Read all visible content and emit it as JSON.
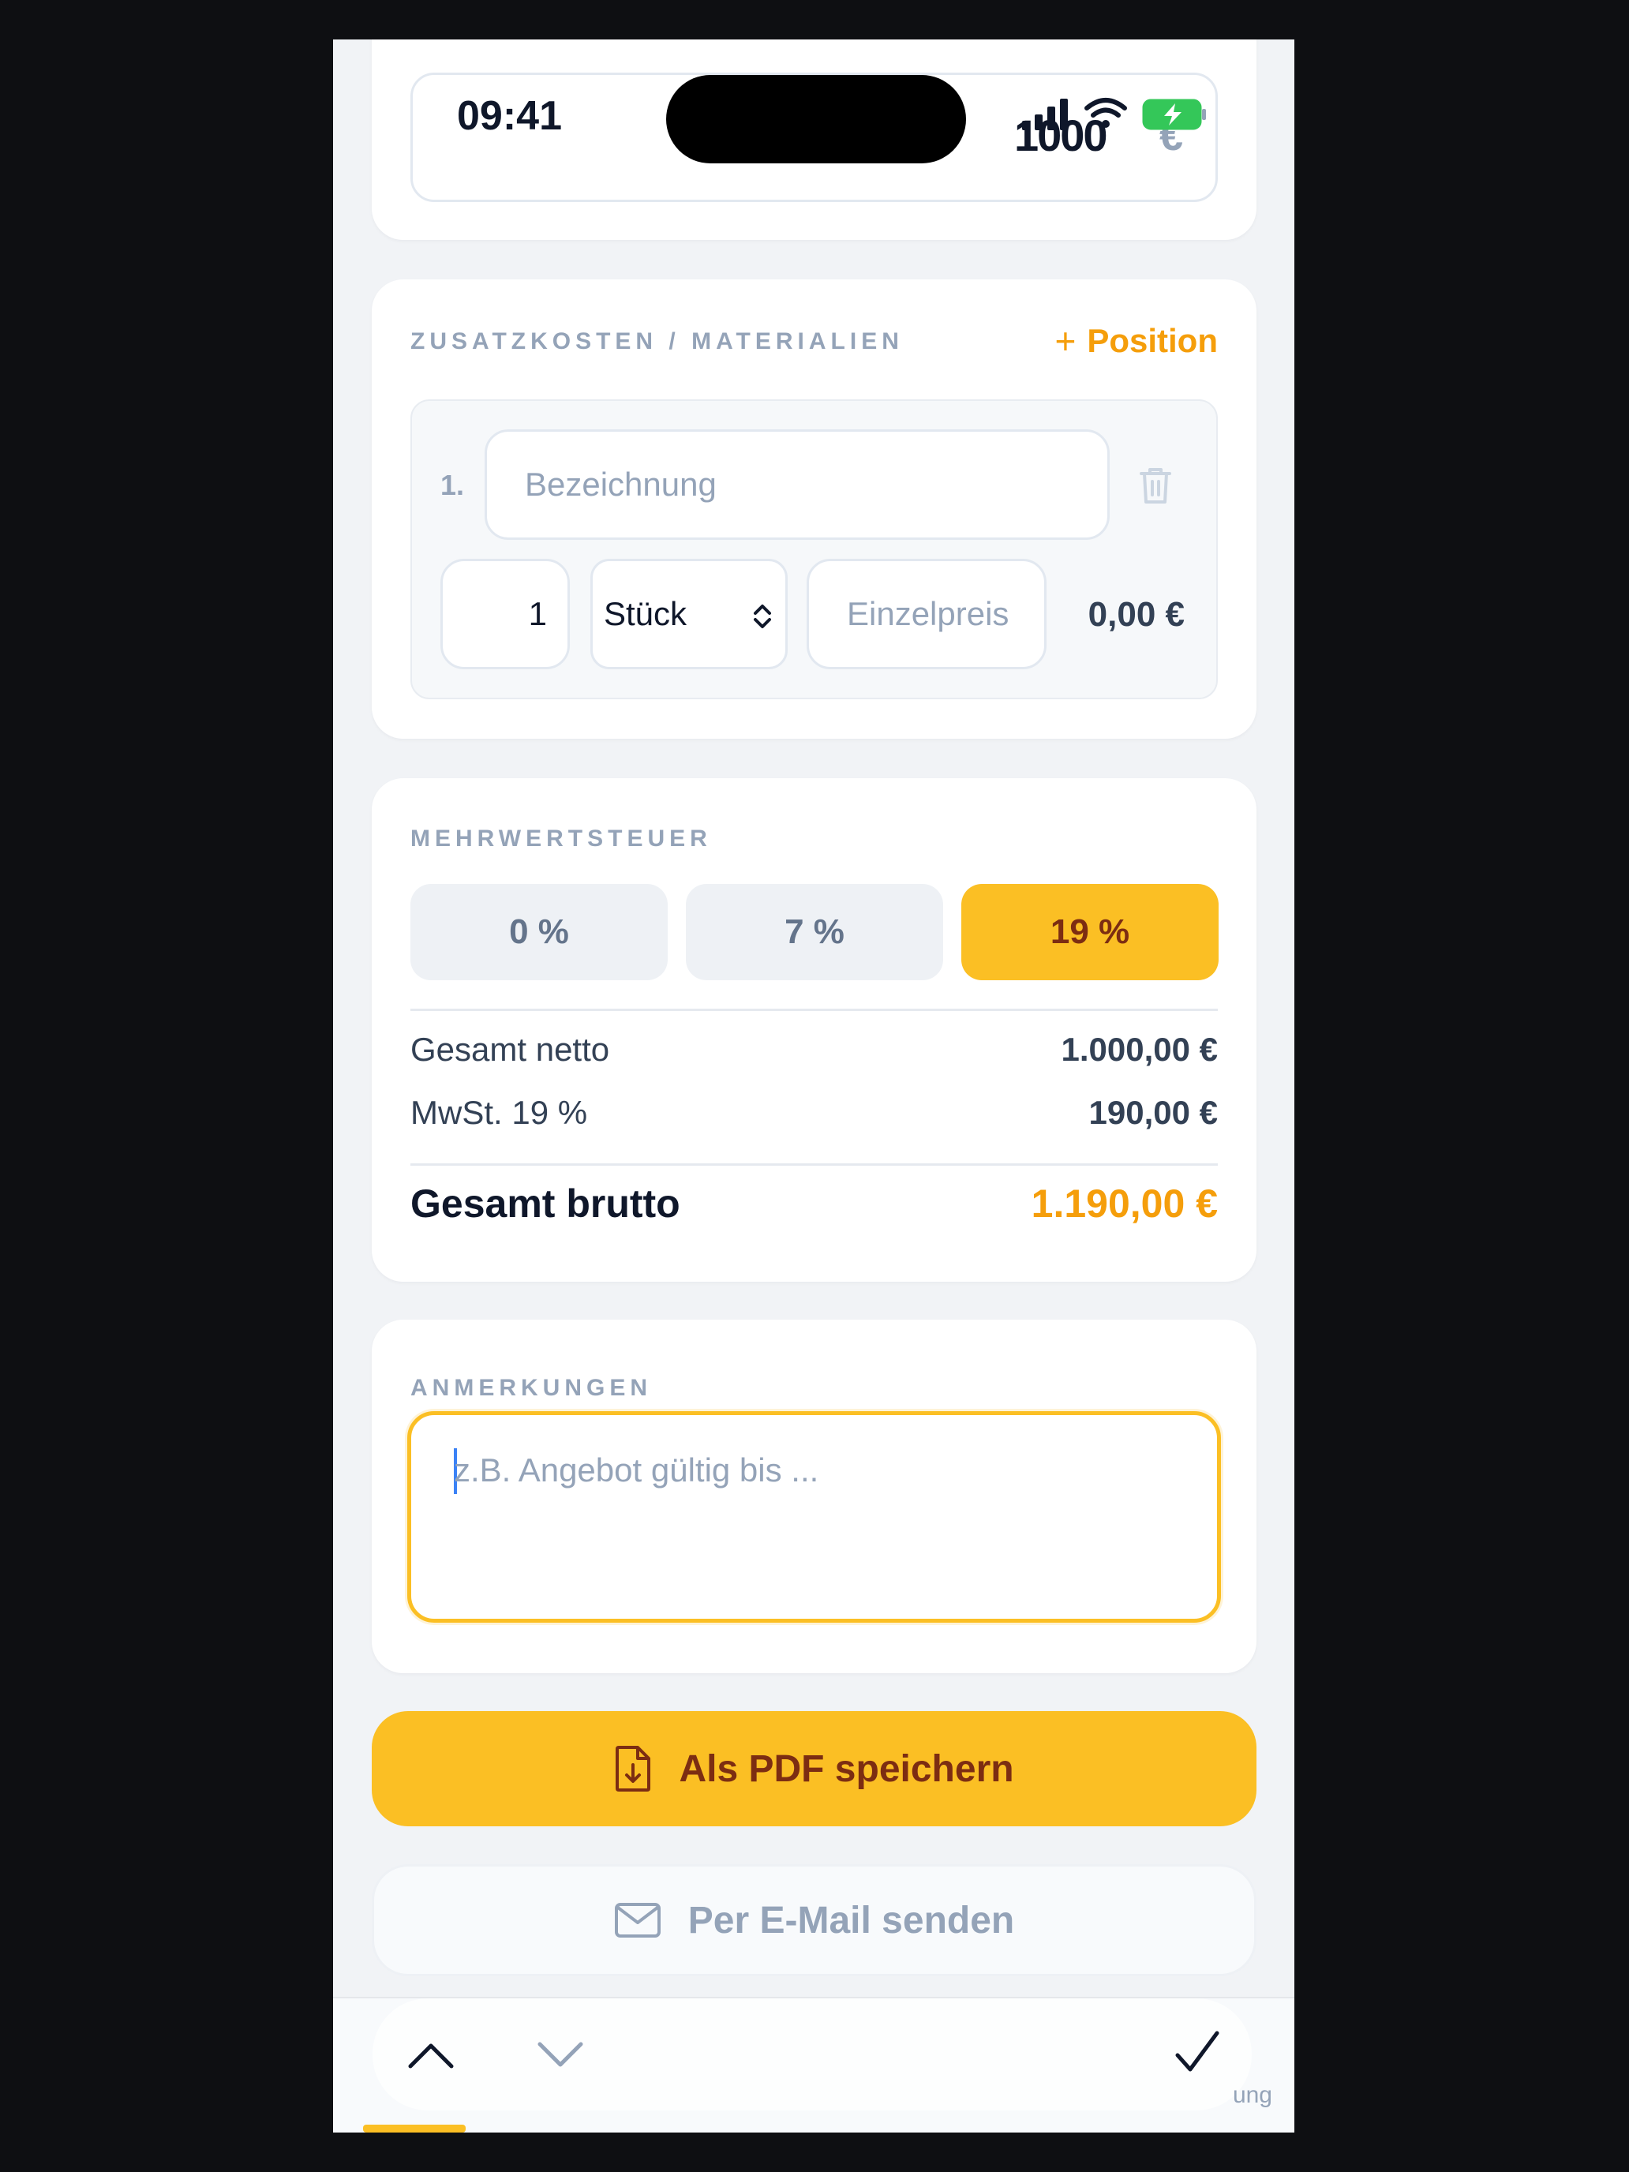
{
  "status_bar": {
    "time": "09:41",
    "overlap_value": "1000",
    "overlap_currency": "€"
  },
  "costs": {
    "section_label": "ZUSATZKOSTEN / MATERIALIEN",
    "add_label": "Position",
    "position": {
      "number": "1.",
      "description_placeholder": "Bezeichnung",
      "quantity": "1",
      "unit": "Stück",
      "price_placeholder": "Einzelpreis",
      "line_total": "0,00 €"
    }
  },
  "vat": {
    "section_label": "MEHRWERTSTEUER",
    "options": [
      "0 %",
      "7 %",
      "19 %"
    ],
    "selected": "19 %",
    "net_label": "Gesamt netto",
    "net_value": "1.000,00 €",
    "vat_label": "MwSt. 19 %",
    "vat_value": "190,00 €",
    "gross_label": "Gesamt brutto",
    "gross_value": "1.190,00 €"
  },
  "notes": {
    "section_label": "ANMERKUNGEN",
    "placeholder": "z.B. Angebot gültig bis ..."
  },
  "actions": {
    "pdf_label": "Als PDF speichern",
    "mail_label": "Per E-Mail senden"
  },
  "tab_bar": {
    "fragment": "ung"
  },
  "colors": {
    "accent": "#fbbf24",
    "accent_text": "#f59e0b",
    "muted": "#94a3b8"
  }
}
